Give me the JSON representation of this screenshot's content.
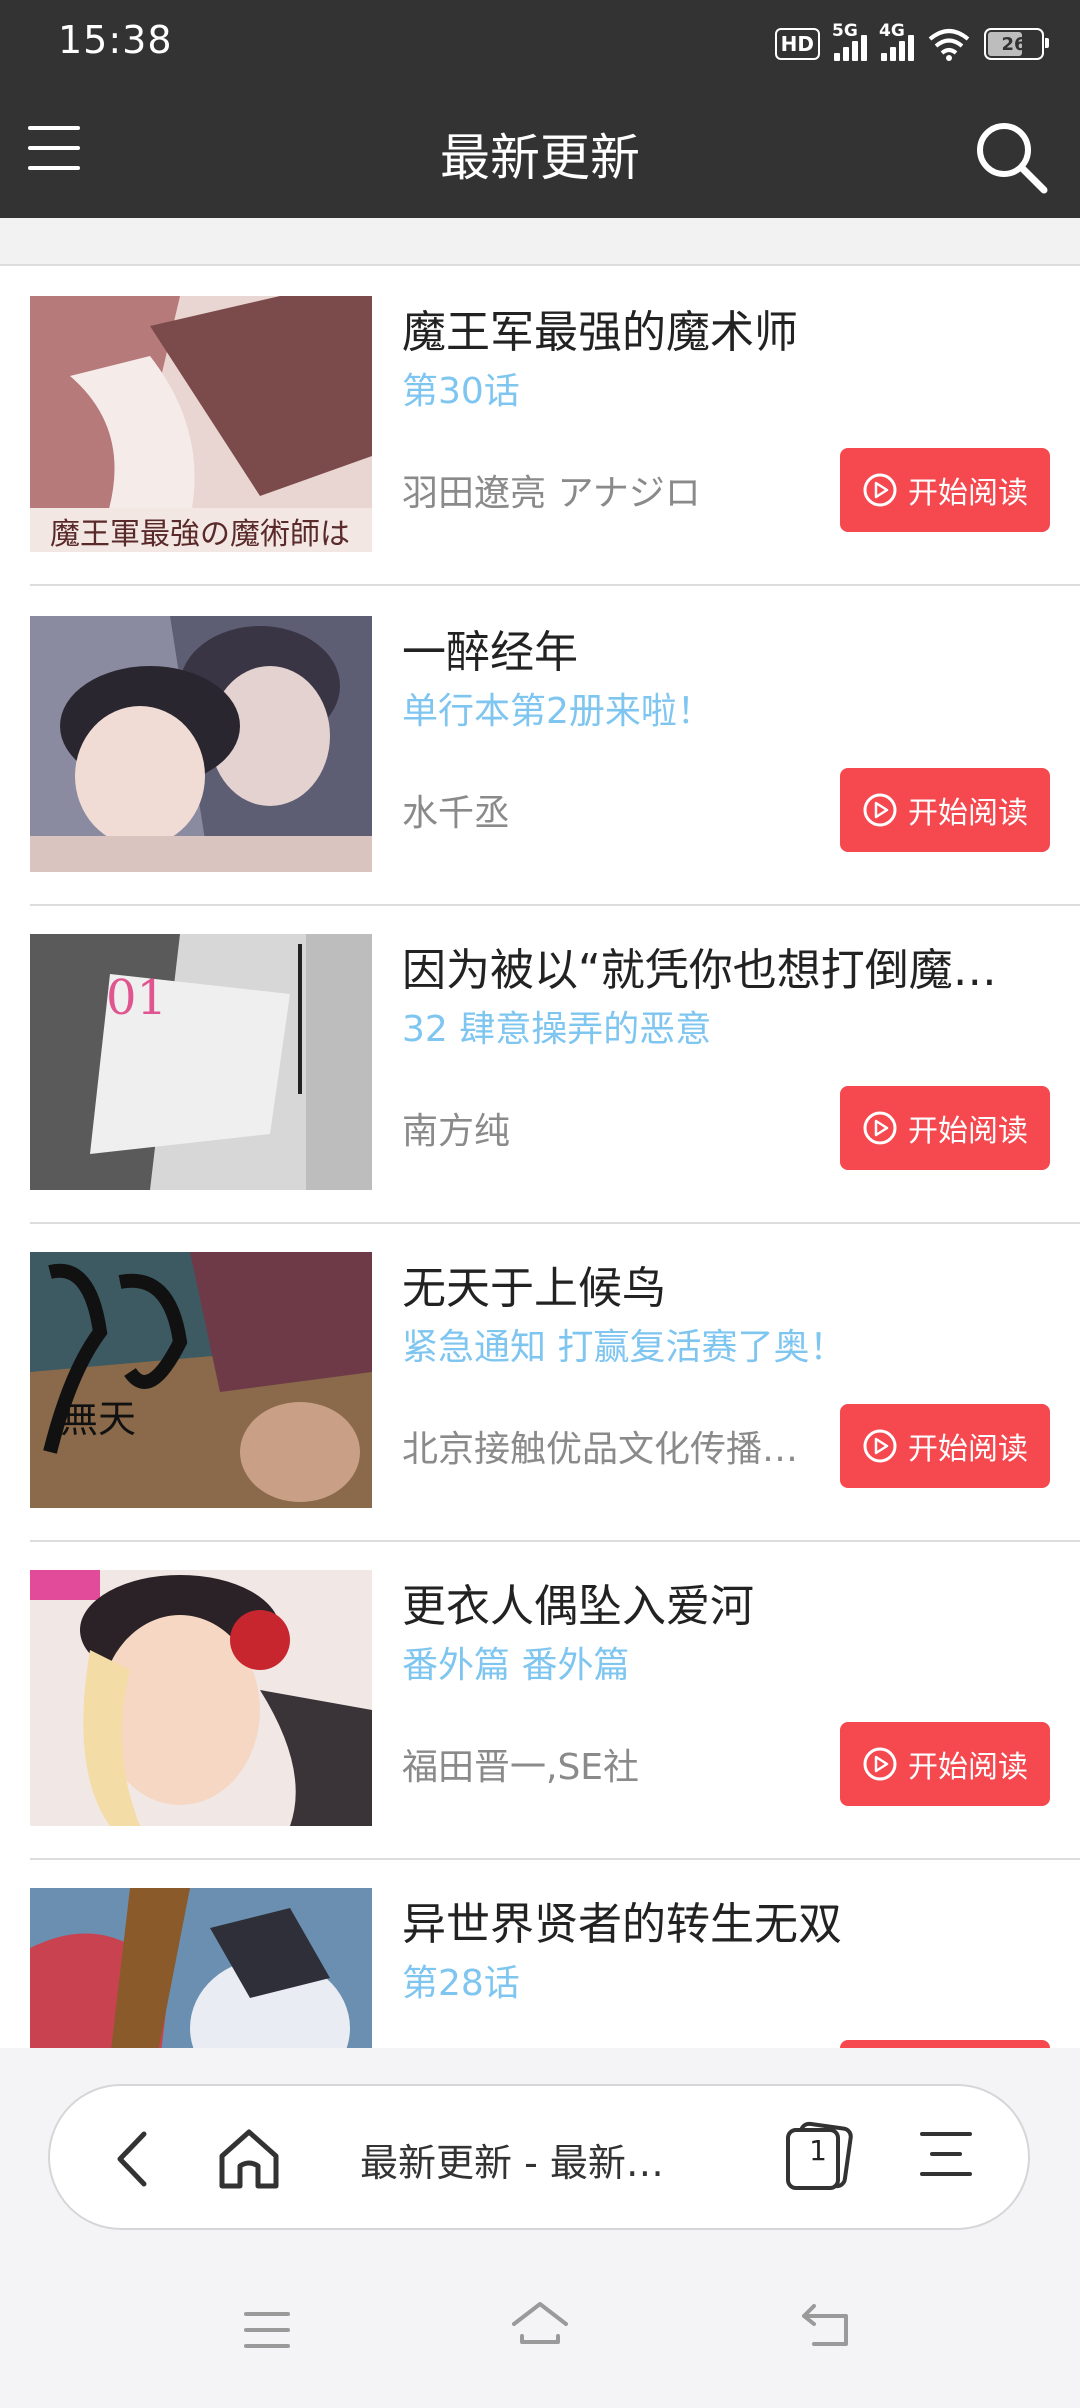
{
  "status_bar": {
    "time": "15:38",
    "hd_badge": "HD",
    "signal_1_label": "5G",
    "signal_2_label": "4G",
    "battery_level": "26",
    "icons": [
      "hd-volte-icon",
      "signal-5g-icon",
      "signal-4g-icon",
      "wifi-icon",
      "battery-icon"
    ]
  },
  "header": {
    "title": "最新更新",
    "background_color": "#333333"
  },
  "comics": [
    {
      "title": "魔王军最强的魔术师",
      "chapter": "第30话",
      "author": "羽田遼亮 アナジロ",
      "button": "开始阅读"
    },
    {
      "title": "一醉经年",
      "chapter": "单行本第2册来啦！",
      "author": "水千丞",
      "button": "开始阅读"
    },
    {
      "title": "因为被以“就凭你也想打倒魔…",
      "chapter": "32 肆意操弄的恶意",
      "author": "南方纯",
      "button": "开始阅读"
    },
    {
      "title": "无天于上候鸟",
      "chapter": "紧急通知 打赢复活赛了奥！",
      "author": "北京接触优品文化传播…",
      "button": "开始阅读"
    },
    {
      "title": "更衣人偶坠入爱河",
      "chapter": "番外篇 番外篇",
      "author": "福田晋一,SE社",
      "button": "开始阅读"
    },
    {
      "title": "异世界贤者的转生无双",
      "chapter": "第28话",
      "author": "",
      "button": ""
    }
  ],
  "colors": {
    "accent_button": "#f5484f",
    "chapter_text": "#7ec5f0",
    "author_text": "#8a8a8a"
  },
  "browser_toolbar": {
    "page_title": "最新更新 - 最新…",
    "tab_count": "1"
  }
}
